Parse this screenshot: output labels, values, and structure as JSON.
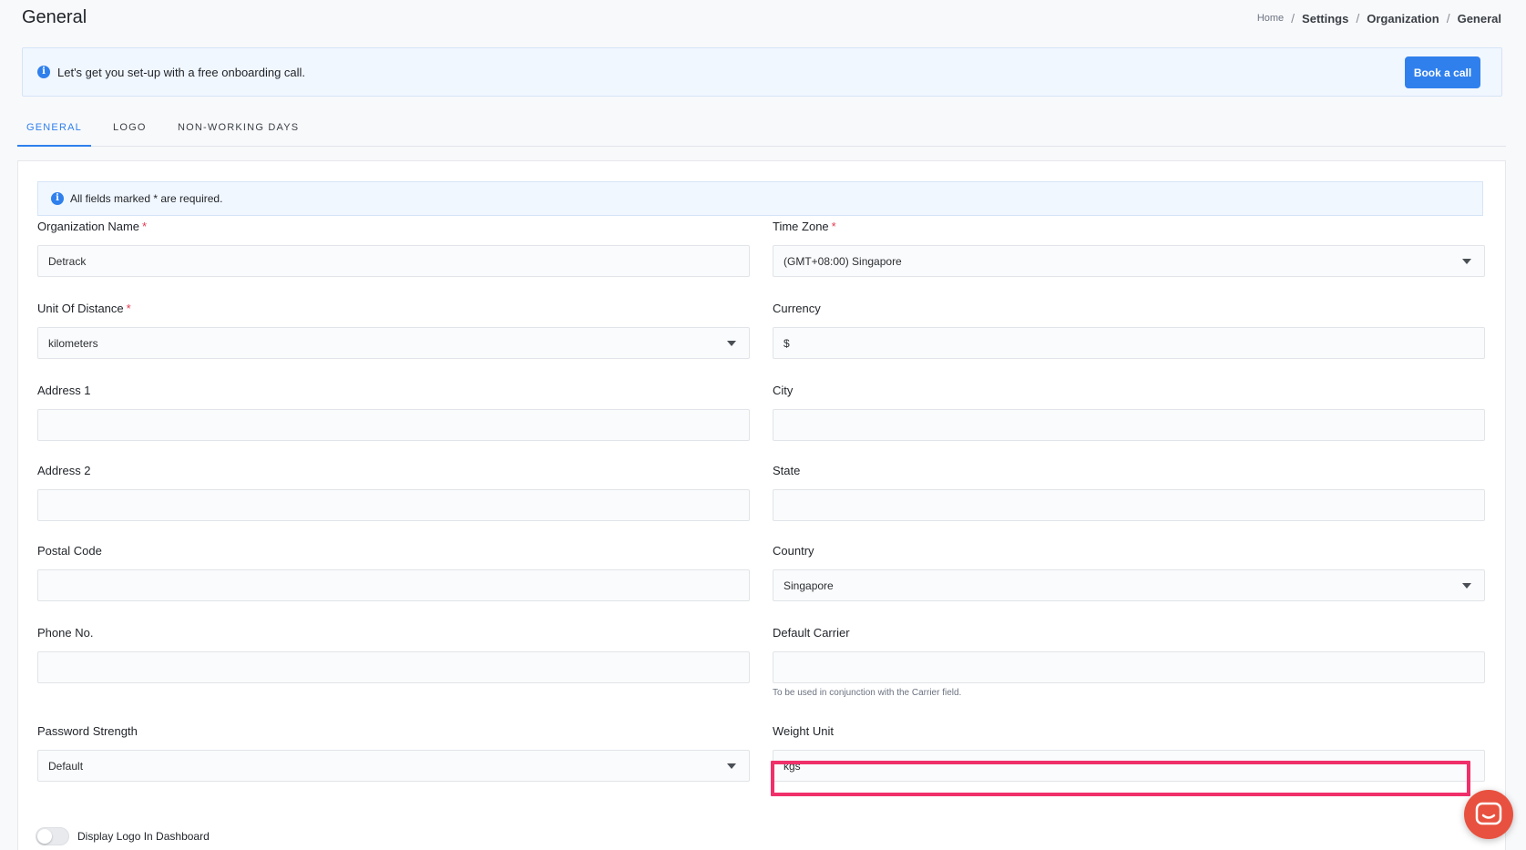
{
  "page": {
    "title": "General"
  },
  "breadcrumb": {
    "home": "Home",
    "settings": "Settings",
    "organization": "Organization",
    "current": "General",
    "separator": "/"
  },
  "onboarding": {
    "message": "Let's get you set-up with a free onboarding call.",
    "button": "Book a call"
  },
  "tabs": [
    {
      "label": "GENERAL",
      "active": true
    },
    {
      "label": "LOGO",
      "active": false
    },
    {
      "label": "NON-WORKING DAYS",
      "active": false
    }
  ],
  "form": {
    "required_note": "All fields marked * are required.",
    "required_mark": "*",
    "organization_name": {
      "label": "Organization Name",
      "value": "Detrack"
    },
    "time_zone": {
      "label": "Time Zone",
      "value": "(GMT+08:00) Singapore"
    },
    "unit_of_distance": {
      "label": "Unit Of Distance",
      "value": "kilometers"
    },
    "currency": {
      "label": "Currency",
      "value": "$"
    },
    "address1": {
      "label": "Address 1",
      "value": ""
    },
    "city": {
      "label": "City",
      "value": ""
    },
    "address2": {
      "label": "Address 2",
      "value": ""
    },
    "state": {
      "label": "State",
      "value": ""
    },
    "postal_code": {
      "label": "Postal Code",
      "value": ""
    },
    "country": {
      "label": "Country",
      "value": "Singapore"
    },
    "phone": {
      "label": "Phone No.",
      "value": ""
    },
    "default_carrier": {
      "label": "Default Carrier",
      "value": "",
      "hint": "To be used in conjunction with the Carrier field."
    },
    "password_strength": {
      "label": "Password Strength",
      "value": "Default"
    },
    "weight_unit": {
      "label": "Weight Unit",
      "value": "kgs"
    },
    "display_logo": {
      "label": "Display Logo In Dashboard",
      "enabled": false
    }
  },
  "colors": {
    "accent": "#2f80ed",
    "required": "#e53950",
    "highlight": "#f0306a",
    "chat": "#e8513f"
  },
  "icons": {
    "info": "info-icon",
    "dropdown": "chevron-down-icon",
    "chat": "chat-icon"
  }
}
